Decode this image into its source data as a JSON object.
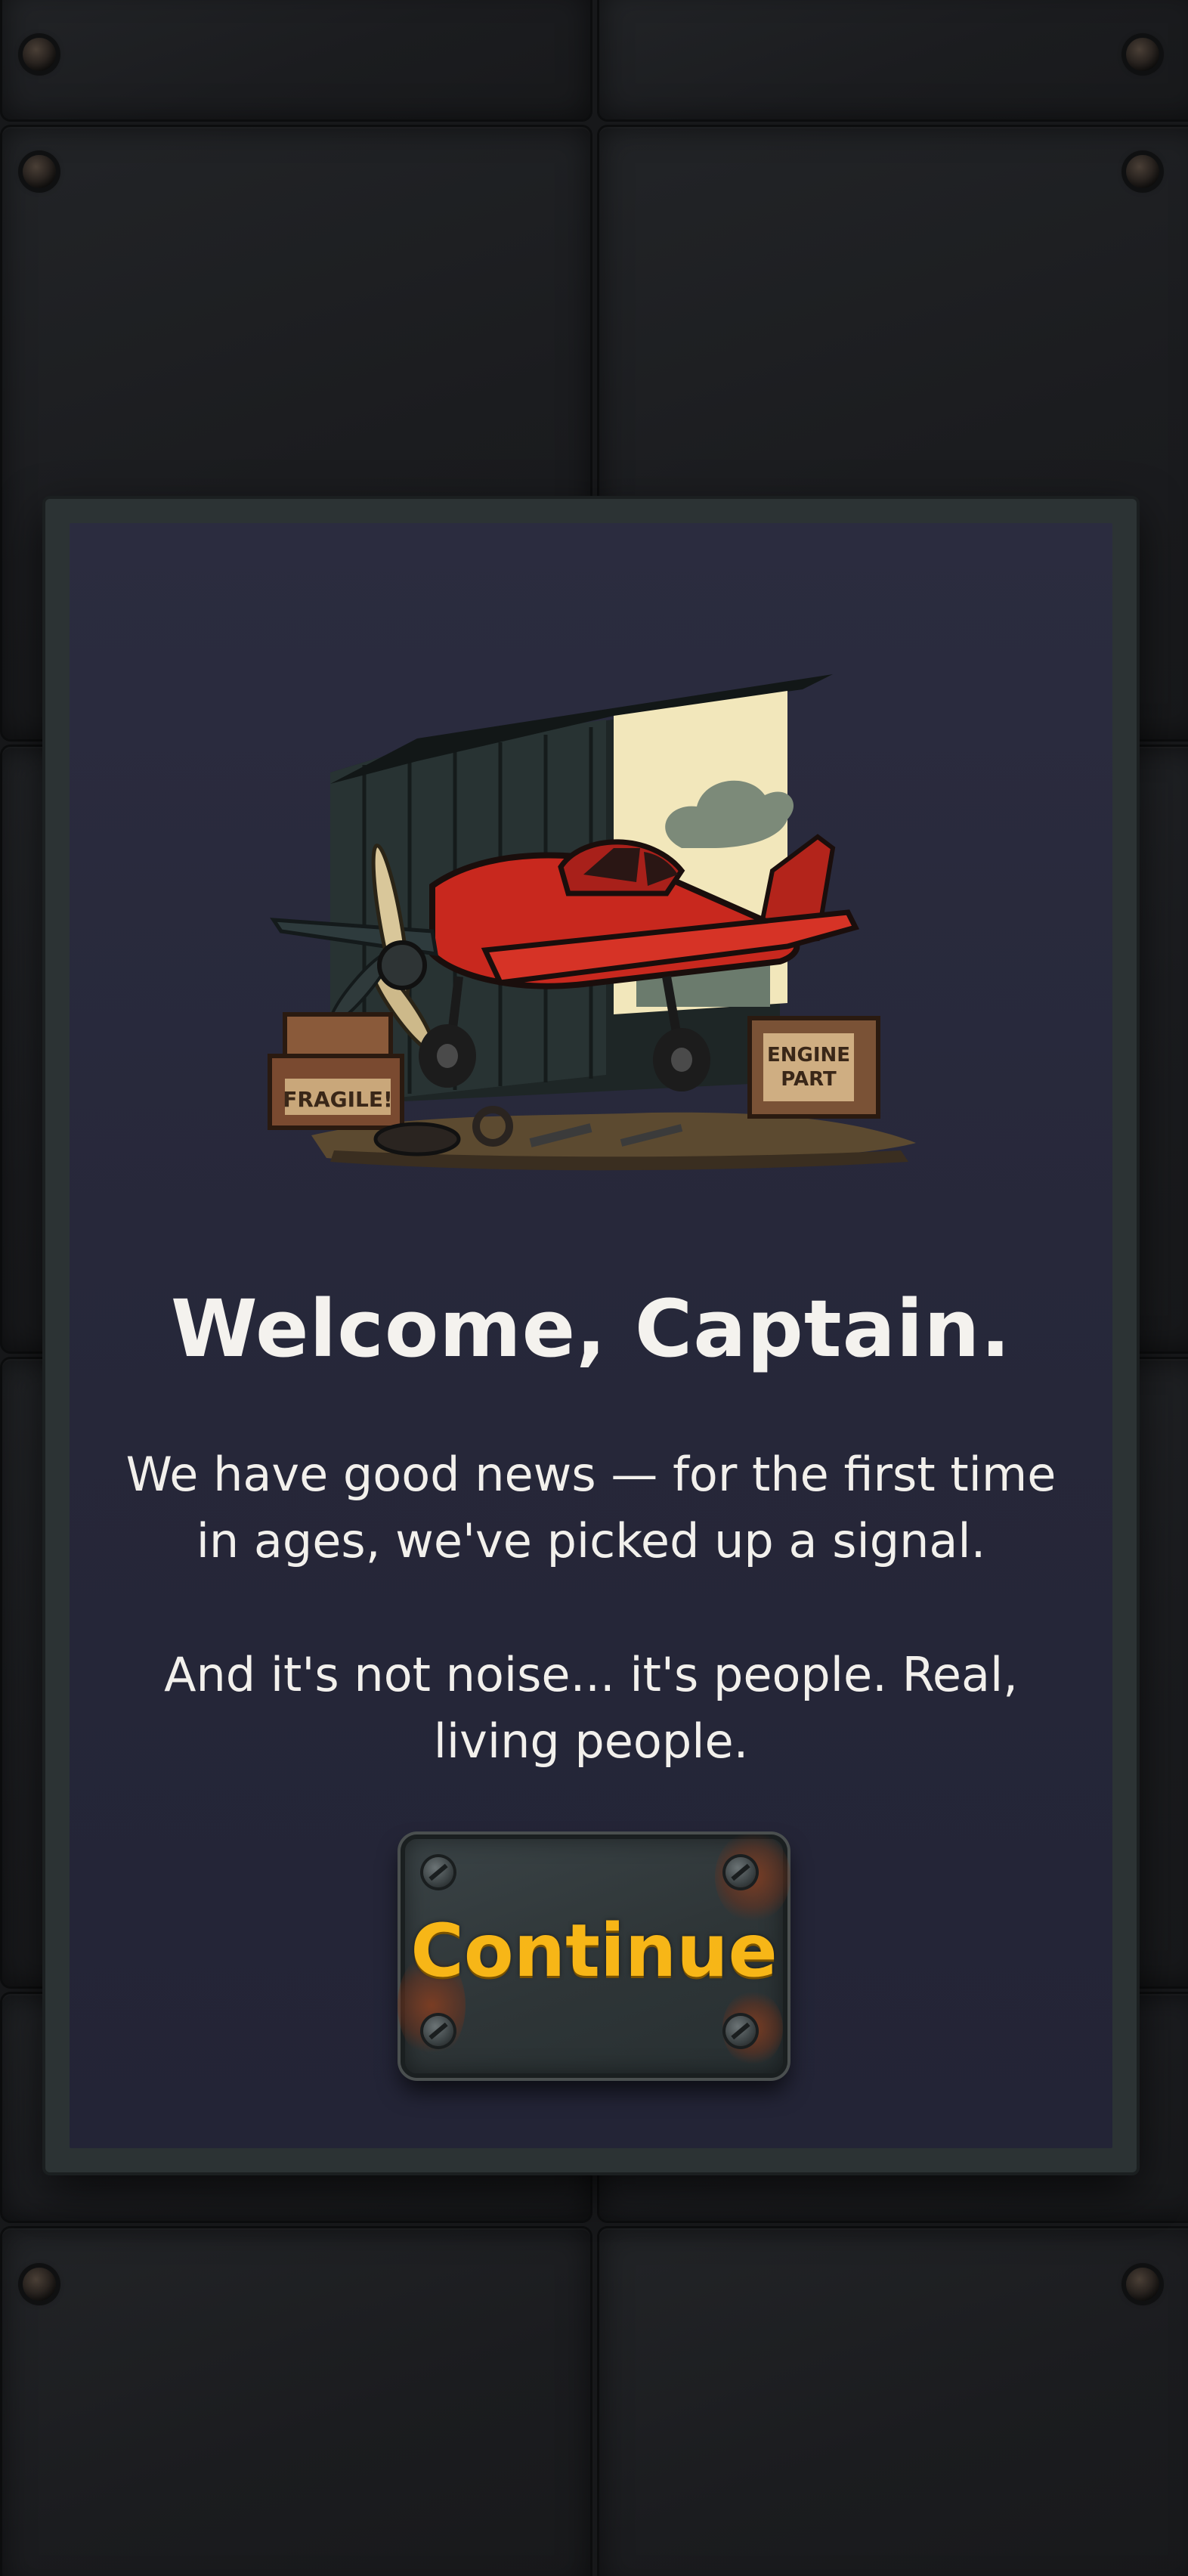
{
  "dialog": {
    "title": "Welcome, Captain.",
    "paragraph_1": "We have good news — for the first time in ages, we've picked up a signal.",
    "paragraph_2": "And it's not noise... it's people. Real, living people.",
    "continue_label": "Continue"
  },
  "illustration": {
    "crate_left_label": "FRAGILE!",
    "crate_right_label_line1": "ENGINE",
    "crate_right_label_line2": "PART"
  },
  "colors": {
    "accent": "#f7b617",
    "panel": "#272839",
    "plane": "#c8281e"
  }
}
